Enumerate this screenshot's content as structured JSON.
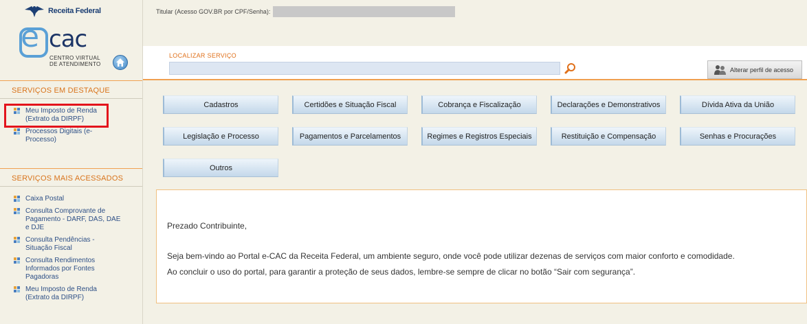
{
  "header": {
    "brand": "Receita Federal",
    "titular_label": "Titular (Acesso GOV.BR por CPF/Senha):"
  },
  "logo": {
    "letter": "e",
    "word": "cac",
    "subtitle_lines": [
      "CENTRO VIRTUAL",
      "DE ATENDIMENTO"
    ]
  },
  "search": {
    "label": "LOCALIZAR SERVIÇO",
    "value": "",
    "placeholder": ""
  },
  "profile_button": {
    "label": "Alterar perfil de acesso"
  },
  "sidebar": {
    "destaque_title": "SERVIÇOS EM DESTAQUE",
    "destaque_items": [
      {
        "label": "Meu Imposto de Renda (Extrato da DIRPF)"
      },
      {
        "label": "Processos Digitais (e-Processo)"
      }
    ],
    "acessados_title": "SERVIÇOS MAIS ACESSADOS",
    "acessados_items": [
      {
        "label": "Caixa Postal"
      },
      {
        "label": "Consulta Comprovante de Pagamento - DARF, DAS, DAE e DJE"
      },
      {
        "label": "Consulta Pendências - Situação Fiscal"
      },
      {
        "label": "Consulta Rendimentos Informados por Fontes Pagadoras"
      },
      {
        "label": "Meu Imposto de Renda (Extrato da DIRPF)"
      }
    ]
  },
  "categories": [
    "Cadastros",
    "Certidões e Situação Fiscal",
    "Cobrança e Fiscalização",
    "Declarações e Demonstrativos",
    "Dívida Ativa da União",
    "Legislação e Processo",
    "Pagamentos e Parcelamentos",
    "Regimes e Registros Especiais",
    "Restituição e Compensação",
    "Senhas e Procurações",
    "Outros"
  ],
  "welcome": {
    "greeting": "Prezado Contribuinte,",
    "line1": "Seja bem-vindo ao Portal e-CAC da Receita Federal, um ambiente seguro, onde você pode utilizar dezenas de serviços com maior conforto e comodidade.",
    "line2": "Ao concluir o uso do portal, para garantir a proteção de seus dados, lembre-se sempre de clicar no botão “Sair com segurança”."
  },
  "colors": {
    "accent_orange": "#d9731a",
    "link_blue": "#2d4f86",
    "highlight_red": "#e3141c",
    "background": "#f3f1e6"
  }
}
